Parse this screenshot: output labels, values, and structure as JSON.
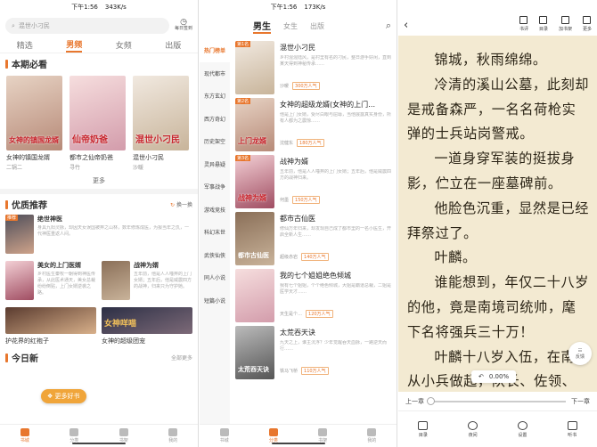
{
  "panel1": {
    "status": {
      "time": "下午1:56",
      "net": "343K/s"
    },
    "search_placeholder": "混世小刁民",
    "checkin_label": "每日签到",
    "tabs": [
      "精选",
      "男频",
      "女频",
      "出版"
    ],
    "section1_title": "本期必看",
    "books": [
      {
        "title": "女神的镇国龙婿",
        "author": "二锅二",
        "cover_text": "女神的镇国龙婿"
      },
      {
        "title": "都市之仙帝奶爸",
        "author": "寻竹",
        "cover_text": "仙帝奶爸"
      },
      {
        "title": "混世小刁民",
        "author": "沙暖",
        "cover_text": "混世小刁民"
      }
    ],
    "more_label": "更多",
    "section2_title": "优质推荐",
    "refresh_label": "换一换",
    "cards": [
      {
        "title": "绝世神医",
        "desc": "身具九阳灵脉，却因天女误国被弃之山林，数年修炼成医，为报当年之仇，一代神医重返人间。",
        "tag": "推荐"
      },
      {
        "title": "美女的上门医婿",
        "desc": "乡村医生秦牧一朝得到神医传承，从此医术通天，美女总裁纷纷倒贴，上门女婿逆袭之路。"
      },
      {
        "title": "战神为婿",
        "desc": "五年前，他是人人唾弃的上门女婿；五年后，他是威震四方的战神，归来只为守护她。"
      }
    ],
    "banners": [
      {
        "title": "护花界的红袍子"
      },
      {
        "title": "女神的超级团宠",
        "cover_text": "女神咩喵"
      }
    ],
    "section3_title": "今日新",
    "section3_more": "全部更多",
    "float_label": "更多好书",
    "nav": [
      "书城",
      "分类",
      "书架",
      "我的"
    ]
  },
  "panel2": {
    "status": {
      "time": "下午1:56",
      "net": "173K/s"
    },
    "tabs": [
      "男生",
      "女生",
      "出版"
    ],
    "side": [
      "热门榜单",
      "现代都市",
      "东方玄幻",
      "西方奇幻",
      "历史架空",
      "灵异悬疑",
      "军事战争",
      "游戏竞技",
      "科幻末世",
      "武侠仙侠",
      "同人小说",
      "短篇小说"
    ],
    "rank": [
      {
        "title": "混世小刁民",
        "desc": "乡村混混陆风，是村里有名的刁民，整日游手好闲，直到某天得到神秘传承……",
        "author": "沙暖",
        "hot": "300万人气",
        "badge": "第1名"
      },
      {
        "title": "女神的超级龙婿(女神的上门…",
        "desc": "他是上门女婿，受尽白眼与屈辱，当他展露真实身份，所有人都为之震惊……",
        "author": "沈健东",
        "hot": "180万人气",
        "badge": "第2名",
        "cover_text": "上门龙婿"
      },
      {
        "title": "战神为婿",
        "desc": "五年前，他是人人唾弃的上门女婿；五年后，他是威震四方的战神归来。",
        "author": "何墨",
        "hot": "150万人气",
        "badge": "第3名",
        "cover_text": "战神为婿"
      },
      {
        "title": "都市古仙医",
        "desc": "修仙万年归来，却发现自己成了都市里的一名小医生，开启全新人生……",
        "author": "超级赤岩",
        "hot": "140万人气",
        "cover_text": "都市古仙医"
      },
      {
        "title": "我的七个姐姐绝色倾城",
        "desc": "我有七个姐姐，个个绝色倾城，大姐是霸道总裁，二姐是医学天才……",
        "author": "天生是个…",
        "hot": "120万人气"
      },
      {
        "title": "太荒吞天诀",
        "desc": "九天之上，谁主沉浮？少年觉醒吞天血脉，一路逆天而行……",
        "author": "铁马飞桥",
        "hot": "110万人气",
        "cover_text": "太荒吞天诀"
      }
    ],
    "nav": [
      "书城",
      "分类",
      "书架",
      "我的"
    ]
  },
  "panel3": {
    "top_icons": [
      "书评",
      "目录",
      "加书架",
      "更多"
    ],
    "paragraphs": [
      "锦城，秋雨绵绵。",
      "冷清的溪山公墓，此刻却是戒备森严，一名名荷枪实弹的士兵站岗警戒。",
      "一道身穿军装的挺拔身影，伫立在一座墓碑前。",
      "他脸色沉重，显然是已经拜祭过了。",
      "叶麟。",
      "谁能想到，年仅二十八岁的他，竟是南境司统帅，麾下名将强兵三十万！",
      "叶麟十八岁入伍，在南境从小兵做起，队长、佐领、参领、统领……统帅，一生戎马，终于成为一颗璀璨的将星。"
    ],
    "progress_pct": "0.00%",
    "prev_chapter": "上一章",
    "next_chapter": "下一章",
    "feedback_label": "反馈",
    "nav": [
      "目录",
      "夜间",
      "设置",
      "听书"
    ]
  }
}
